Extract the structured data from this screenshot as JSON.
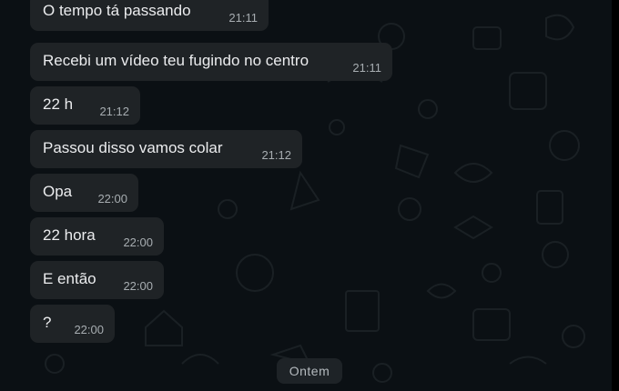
{
  "messages": [
    {
      "text": "O tempo tá passando",
      "time": "21:11"
    },
    {
      "text": "Recebi um vídeo teu fugindo no centro",
      "time": "21:11"
    },
    {
      "text": "22 h",
      "time": "21:12"
    },
    {
      "text": "Passou disso vamos colar",
      "time": "21:12"
    },
    {
      "text": "Opa",
      "time": "22:00"
    },
    {
      "text": "22 hora",
      "time": "22:00"
    },
    {
      "text": "E então",
      "time": "22:00"
    },
    {
      "text": "?",
      "time": "22:00"
    }
  ],
  "date_separator": "Ontem",
  "colors": {
    "background": "#0b1014",
    "bubble": "#1f2326",
    "text": "#ebecee",
    "time": "#a7adb1"
  }
}
